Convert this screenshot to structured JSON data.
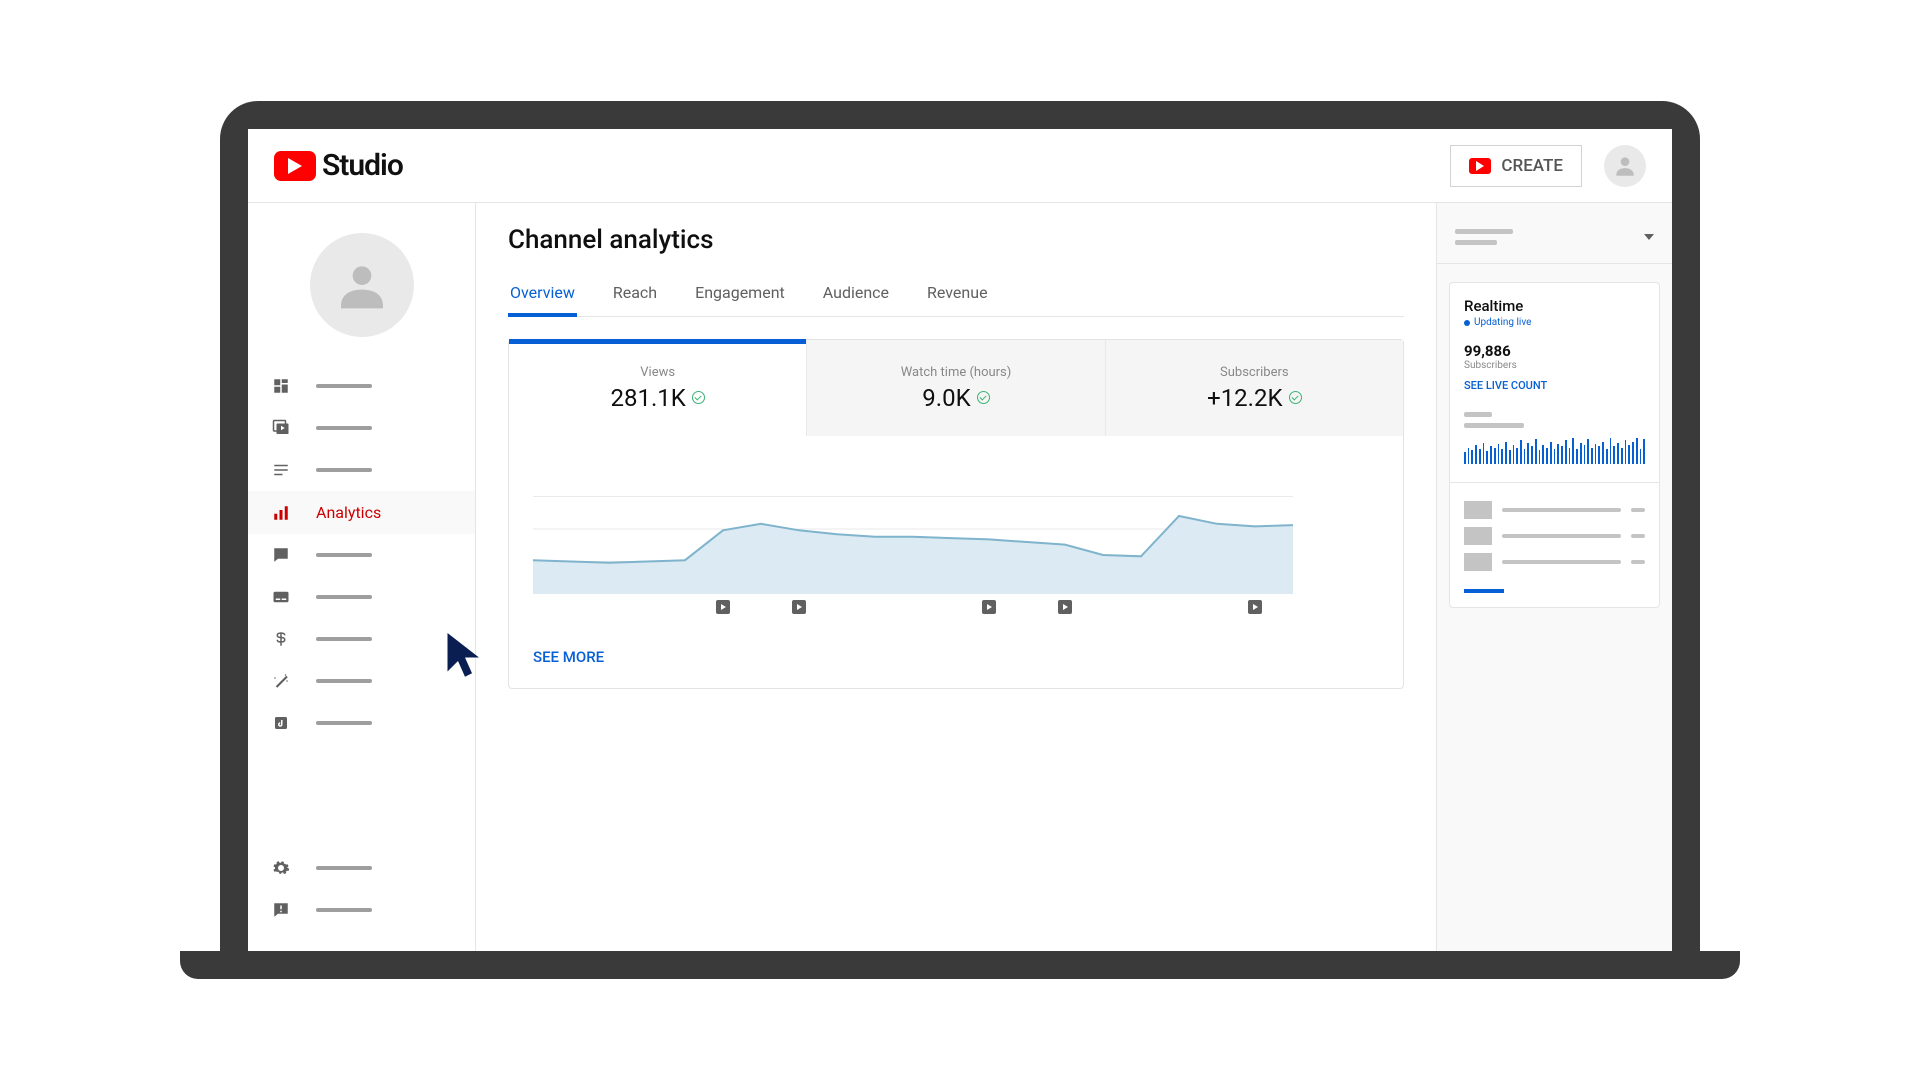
{
  "brand": {
    "name": "Studio"
  },
  "header": {
    "create_label": "CREATE"
  },
  "sidebar": {
    "active_index": 3,
    "items": [
      {
        "id": "dashboard",
        "icon": "dashboard"
      },
      {
        "id": "content",
        "icon": "video-library"
      },
      {
        "id": "playlists",
        "icon": "playlist"
      },
      {
        "id": "analytics",
        "icon": "analytics",
        "label": "Analytics"
      },
      {
        "id": "comments",
        "icon": "comment"
      },
      {
        "id": "subtitles",
        "icon": "subtitles"
      },
      {
        "id": "monetization",
        "icon": "dollar"
      },
      {
        "id": "customization",
        "icon": "magic-wand"
      },
      {
        "id": "audio",
        "icon": "audio-library"
      }
    ],
    "bottom_items": [
      {
        "id": "settings",
        "icon": "gear"
      },
      {
        "id": "feedback",
        "icon": "feedback"
      }
    ]
  },
  "page": {
    "title": "Channel analytics",
    "tabs": [
      "Overview",
      "Reach",
      "Engagement",
      "Audience",
      "Revenue"
    ],
    "active_tab": 0
  },
  "metrics": [
    {
      "label": "Views",
      "value": "281.1K",
      "trend": "up",
      "active": true
    },
    {
      "label": "Watch time (hours)",
      "value": "9.0K",
      "trend": "up",
      "active": false
    },
    {
      "label": "Subscribers",
      "value": "+12.2K",
      "trend": "up",
      "active": false
    }
  ],
  "see_more": "SEE MORE",
  "realtime": {
    "title": "Realtime",
    "sub": "Updating live",
    "count": "99,886",
    "count_label": "Subscribers",
    "link": "SEE LIVE COUNT"
  },
  "chart_data": {
    "type": "area",
    "title": "Views",
    "x_index": [
      0,
      1,
      2,
      3,
      4,
      5,
      6,
      7,
      8,
      9,
      10,
      11,
      12,
      13,
      14,
      15,
      16,
      17,
      18,
      19,
      20
    ],
    "values": [
      26,
      25,
      24,
      25,
      26,
      49,
      54,
      49,
      46,
      44,
      44,
      43,
      42,
      40,
      38,
      30,
      29,
      60,
      54,
      52,
      53
    ],
    "ylim": [
      0,
      100
    ],
    "video_markers_at": [
      5,
      7,
      12,
      14,
      19
    ],
    "xlabel": "",
    "ylabel": ""
  },
  "spark_bars": [
    8,
    12,
    10,
    14,
    11,
    16,
    9,
    13,
    12,
    15,
    11,
    17,
    10,
    14,
    12,
    18,
    11,
    16,
    13,
    19,
    10,
    14,
    12,
    17,
    11,
    15,
    13,
    18,
    12,
    20,
    11,
    16,
    14,
    19,
    12,
    15,
    13,
    17,
    11,
    20,
    13,
    16,
    12,
    18,
    14,
    17,
    20,
    11,
    19
  ]
}
